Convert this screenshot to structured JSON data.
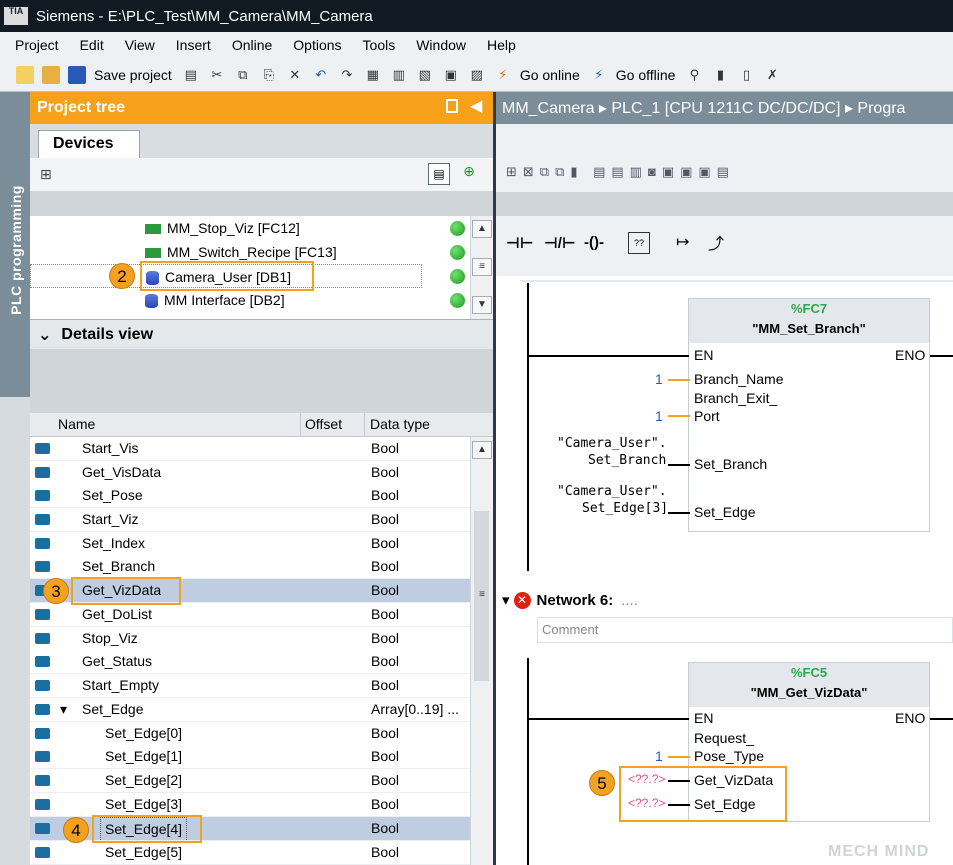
{
  "window": {
    "title": "Siemens - E:\\PLC_Test\\MM_Camera\\MM_Camera",
    "logo": "TIA"
  },
  "menu": [
    "Project",
    "Edit",
    "View",
    "Insert",
    "Online",
    "Options",
    "Tools",
    "Window",
    "Help"
  ],
  "toolbar": {
    "save": "Save project",
    "go_online": "Go online",
    "go_offline": "Go offline"
  },
  "sidetab": {
    "label": "PLC programming"
  },
  "project_tree": {
    "title": "Project tree",
    "tab": "Devices",
    "items": [
      {
        "label": "MM_Stop_Viz [FC12]",
        "type": "fc"
      },
      {
        "label": "MM_Switch_Recipe [FC13]",
        "type": "fc"
      },
      {
        "label": "Camera_User [DB1]",
        "type": "db"
      },
      {
        "label": "MM Interface [DB2]",
        "type": "db"
      }
    ]
  },
  "details": {
    "title": "Details view",
    "columns": {
      "name": "Name",
      "offset": "Offset",
      "type": "Data type"
    },
    "rows": [
      {
        "name": "Start_Vis",
        "type": "Bool"
      },
      {
        "name": "Get_VisData",
        "type": "Bool"
      },
      {
        "name": "Set_Pose",
        "type": "Bool"
      },
      {
        "name": "Start_Viz",
        "type": "Bool"
      },
      {
        "name": "Set_Index",
        "type": "Bool"
      },
      {
        "name": "Set_Branch",
        "type": "Bool"
      },
      {
        "name": "Get_VizData",
        "type": "Bool"
      },
      {
        "name": "Get_DoList",
        "type": "Bool"
      },
      {
        "name": "Stop_Viz",
        "type": "Bool"
      },
      {
        "name": "Get_Status",
        "type": "Bool"
      },
      {
        "name": "Start_Empty",
        "type": "Bool"
      },
      {
        "name": "Set_Edge",
        "type": "Array[0..19] ..."
      },
      {
        "name": "Set_Edge[0]",
        "type": "Bool"
      },
      {
        "name": "Set_Edge[1]",
        "type": "Bool"
      },
      {
        "name": "Set_Edge[2]",
        "type": "Bool"
      },
      {
        "name": "Set_Edge[3]",
        "type": "Bool"
      },
      {
        "name": "Set_Edge[4]",
        "type": "Bool"
      },
      {
        "name": "Set_Edge[5]",
        "type": "Bool"
      }
    ]
  },
  "editor": {
    "breadcrumb": "MM_Camera  ▸  PLC_1 [CPU 1211C DC/DC/DC]  ▸  Progra",
    "block1": {
      "num": "%FC7",
      "name": "\"MM_Set_Branch\"",
      "en": "EN",
      "eno": "ENO",
      "p1": "Branch_Name",
      "p2a": "Branch_Exit_",
      "p2b": "Port",
      "p3": "Set_Branch",
      "p4": "Set_Edge",
      "v1": "1",
      "v2": "1",
      "a3a": "\"Camera_User\".",
      "a3b": "Set_Branch",
      "a4a": "\"Camera_User\".",
      "a4b": "Set_Edge[3]"
    },
    "network6": {
      "label": "Network 6:",
      "dots": "....",
      "comment": "Comment"
    },
    "block2": {
      "num": "%FC5",
      "name": "\"MM_Get_VizData\"",
      "en": "EN",
      "eno": "ENO",
      "p1a": "Request_",
      "p1b": "Pose_Type",
      "p2": "Get_VizData",
      "p3": "Set_Edge",
      "v1": "1",
      "q": "<??.?>"
    }
  },
  "badges": [
    "2",
    "3",
    "4",
    "5"
  ],
  "watermark": "MECH MIND"
}
